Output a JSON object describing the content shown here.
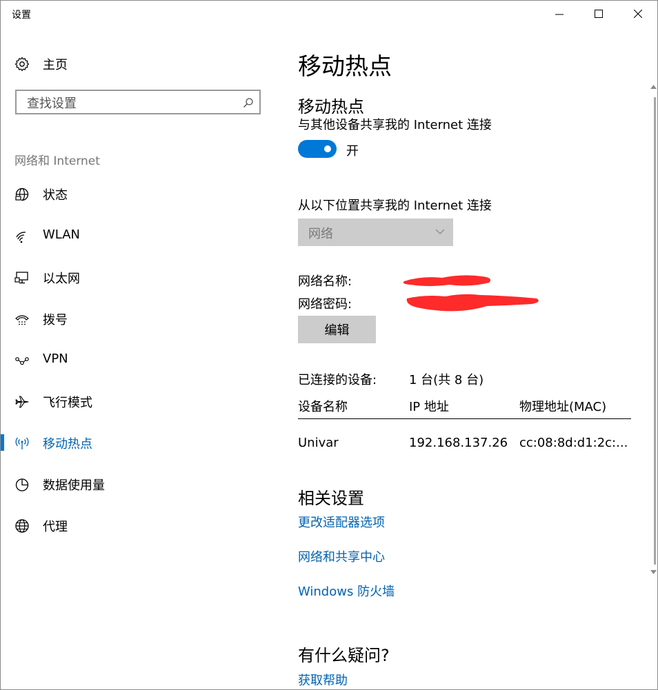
{
  "window": {
    "title": "设置"
  },
  "sidebar": {
    "home_label": "主页",
    "search_placeholder": "查找设置",
    "section_label": "网络和 Internet",
    "items": [
      {
        "label": "状态",
        "icon": "globe-status-icon"
      },
      {
        "label": "WLAN",
        "icon": "wifi-icon"
      },
      {
        "label": "以太网",
        "icon": "ethernet-icon"
      },
      {
        "label": "拨号",
        "icon": "dialup-icon"
      },
      {
        "label": "VPN",
        "icon": "vpn-icon"
      },
      {
        "label": "飞行模式",
        "icon": "airplane-icon"
      },
      {
        "label": "移动热点",
        "icon": "hotspot-icon",
        "active": true
      },
      {
        "label": "数据使用量",
        "icon": "pie-chart-icon"
      },
      {
        "label": "代理",
        "icon": "globe-icon"
      }
    ]
  },
  "main": {
    "page_title": "移动热点",
    "hotspot_heading": "移动热点",
    "share_desc": "与其他设备共享我的 Internet 连接",
    "toggle_state": "开",
    "toggle_on": true,
    "share_from_label": "从以下位置共享我的 Internet 连接",
    "share_from_value": "网络",
    "network_name_label": "网络名称:",
    "network_password_label": "网络密码:",
    "edit_button": "编辑",
    "connected_label": "已连接的设备:",
    "connected_value": "1 台(共 8 台)",
    "table": {
      "headers": [
        "设备名称",
        "IP 地址",
        "物理地址(MAC)"
      ],
      "rows": [
        [
          "Univar",
          "192.168.137.26",
          "cc:08:8d:d1:2c:..."
        ]
      ]
    },
    "related_heading": "相关设置",
    "related_links": [
      "更改适配器选项",
      "网络和共享中心",
      "Windows 防火墙"
    ],
    "question_heading": "有什么疑问?",
    "help_link": "获取帮助"
  },
  "colors": {
    "accent": "#0078d7",
    "link": "#0063b1",
    "redaction": "#ff2a2a"
  }
}
